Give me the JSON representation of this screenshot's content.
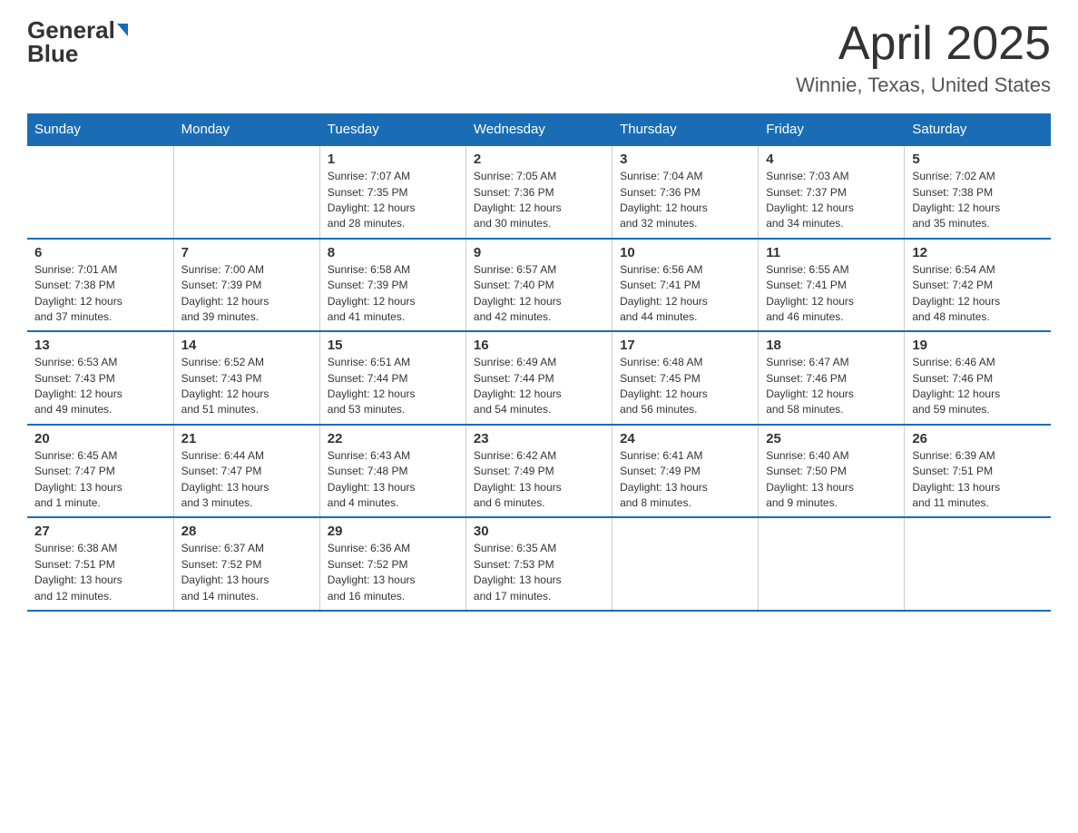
{
  "header": {
    "logo_text_general": "General",
    "logo_text_blue": "Blue",
    "month_title": "April 2025",
    "location": "Winnie, Texas, United States"
  },
  "days_of_week": [
    "Sunday",
    "Monday",
    "Tuesday",
    "Wednesday",
    "Thursday",
    "Friday",
    "Saturday"
  ],
  "weeks": [
    [
      {
        "day": "",
        "info": ""
      },
      {
        "day": "",
        "info": ""
      },
      {
        "day": "1",
        "info": "Sunrise: 7:07 AM\nSunset: 7:35 PM\nDaylight: 12 hours\nand 28 minutes."
      },
      {
        "day": "2",
        "info": "Sunrise: 7:05 AM\nSunset: 7:36 PM\nDaylight: 12 hours\nand 30 minutes."
      },
      {
        "day": "3",
        "info": "Sunrise: 7:04 AM\nSunset: 7:36 PM\nDaylight: 12 hours\nand 32 minutes."
      },
      {
        "day": "4",
        "info": "Sunrise: 7:03 AM\nSunset: 7:37 PM\nDaylight: 12 hours\nand 34 minutes."
      },
      {
        "day": "5",
        "info": "Sunrise: 7:02 AM\nSunset: 7:38 PM\nDaylight: 12 hours\nand 35 minutes."
      }
    ],
    [
      {
        "day": "6",
        "info": "Sunrise: 7:01 AM\nSunset: 7:38 PM\nDaylight: 12 hours\nand 37 minutes."
      },
      {
        "day": "7",
        "info": "Sunrise: 7:00 AM\nSunset: 7:39 PM\nDaylight: 12 hours\nand 39 minutes."
      },
      {
        "day": "8",
        "info": "Sunrise: 6:58 AM\nSunset: 7:39 PM\nDaylight: 12 hours\nand 41 minutes."
      },
      {
        "day": "9",
        "info": "Sunrise: 6:57 AM\nSunset: 7:40 PM\nDaylight: 12 hours\nand 42 minutes."
      },
      {
        "day": "10",
        "info": "Sunrise: 6:56 AM\nSunset: 7:41 PM\nDaylight: 12 hours\nand 44 minutes."
      },
      {
        "day": "11",
        "info": "Sunrise: 6:55 AM\nSunset: 7:41 PM\nDaylight: 12 hours\nand 46 minutes."
      },
      {
        "day": "12",
        "info": "Sunrise: 6:54 AM\nSunset: 7:42 PM\nDaylight: 12 hours\nand 48 minutes."
      }
    ],
    [
      {
        "day": "13",
        "info": "Sunrise: 6:53 AM\nSunset: 7:43 PM\nDaylight: 12 hours\nand 49 minutes."
      },
      {
        "day": "14",
        "info": "Sunrise: 6:52 AM\nSunset: 7:43 PM\nDaylight: 12 hours\nand 51 minutes."
      },
      {
        "day": "15",
        "info": "Sunrise: 6:51 AM\nSunset: 7:44 PM\nDaylight: 12 hours\nand 53 minutes."
      },
      {
        "day": "16",
        "info": "Sunrise: 6:49 AM\nSunset: 7:44 PM\nDaylight: 12 hours\nand 54 minutes."
      },
      {
        "day": "17",
        "info": "Sunrise: 6:48 AM\nSunset: 7:45 PM\nDaylight: 12 hours\nand 56 minutes."
      },
      {
        "day": "18",
        "info": "Sunrise: 6:47 AM\nSunset: 7:46 PM\nDaylight: 12 hours\nand 58 minutes."
      },
      {
        "day": "19",
        "info": "Sunrise: 6:46 AM\nSunset: 7:46 PM\nDaylight: 12 hours\nand 59 minutes."
      }
    ],
    [
      {
        "day": "20",
        "info": "Sunrise: 6:45 AM\nSunset: 7:47 PM\nDaylight: 13 hours\nand 1 minute."
      },
      {
        "day": "21",
        "info": "Sunrise: 6:44 AM\nSunset: 7:47 PM\nDaylight: 13 hours\nand 3 minutes."
      },
      {
        "day": "22",
        "info": "Sunrise: 6:43 AM\nSunset: 7:48 PM\nDaylight: 13 hours\nand 4 minutes."
      },
      {
        "day": "23",
        "info": "Sunrise: 6:42 AM\nSunset: 7:49 PM\nDaylight: 13 hours\nand 6 minutes."
      },
      {
        "day": "24",
        "info": "Sunrise: 6:41 AM\nSunset: 7:49 PM\nDaylight: 13 hours\nand 8 minutes."
      },
      {
        "day": "25",
        "info": "Sunrise: 6:40 AM\nSunset: 7:50 PM\nDaylight: 13 hours\nand 9 minutes."
      },
      {
        "day": "26",
        "info": "Sunrise: 6:39 AM\nSunset: 7:51 PM\nDaylight: 13 hours\nand 11 minutes."
      }
    ],
    [
      {
        "day": "27",
        "info": "Sunrise: 6:38 AM\nSunset: 7:51 PM\nDaylight: 13 hours\nand 12 minutes."
      },
      {
        "day": "28",
        "info": "Sunrise: 6:37 AM\nSunset: 7:52 PM\nDaylight: 13 hours\nand 14 minutes."
      },
      {
        "day": "29",
        "info": "Sunrise: 6:36 AM\nSunset: 7:52 PM\nDaylight: 13 hours\nand 16 minutes."
      },
      {
        "day": "30",
        "info": "Sunrise: 6:35 AM\nSunset: 7:53 PM\nDaylight: 13 hours\nand 17 minutes."
      },
      {
        "day": "",
        "info": ""
      },
      {
        "day": "",
        "info": ""
      },
      {
        "day": "",
        "info": ""
      }
    ]
  ]
}
